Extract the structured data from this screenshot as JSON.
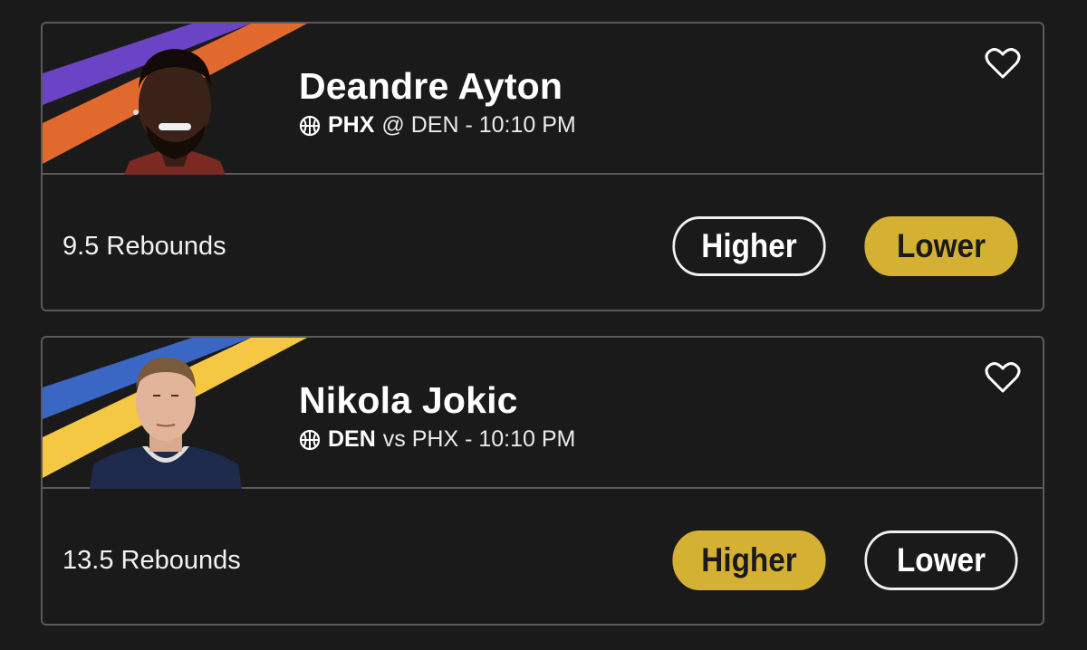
{
  "colors": {
    "accent_gold": "#d4b133",
    "card_border": "#5a5a5a",
    "background": "#1a1a1a"
  },
  "cards": [
    {
      "player_name": "Deandre Ayton",
      "team": "PHX",
      "matchup_rest": "@ DEN - 10:10 PM",
      "stat_line": "9.5 Rebounds",
      "higher_label": "Higher",
      "lower_label": "Lower",
      "selected": "Lower",
      "stripe_colors": [
        "#6a44c4",
        "#e2692d"
      ],
      "icons": [
        "basketball-icon",
        "heart-icon"
      ]
    },
    {
      "player_name": "Nikola Jokic",
      "team": "DEN",
      "matchup_rest": "vs PHX - 10:10 PM",
      "stat_line": "13.5 Rebounds",
      "higher_label": "Higher",
      "lower_label": "Lower",
      "selected": "Higher",
      "stripe_colors": [
        "#3b67c4",
        "#f5c843"
      ],
      "icons": [
        "basketball-icon",
        "heart-icon"
      ]
    }
  ]
}
